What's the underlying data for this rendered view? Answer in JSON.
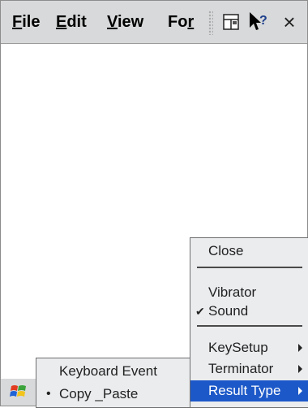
{
  "menubar": {
    "file": {
      "u": "F",
      "rest": "ile"
    },
    "edit": {
      "u": "E",
      "rest": "dit"
    },
    "view": {
      "u": "V",
      "rest": "iew"
    },
    "format": {
      "pre": "Fo",
      "u": "r"
    },
    "close_glyph": "×"
  },
  "main_menu": {
    "close": "Close",
    "vibrator": "Vibrator",
    "sound_check": "✔",
    "sound": "Sound",
    "keysetup": "KeySetup",
    "terminator": "Terminator",
    "result_type": "Result Type"
  },
  "sub_menu": {
    "keyboard_event": "Keyboard Event",
    "bullet": "•",
    "copy_paste": "Copy _Paste"
  },
  "colors": {
    "highlight": "#1c58c8",
    "bar": "#d8d9da",
    "menu_bg": "#ebecee"
  },
  "icons": {
    "layout": "layout-icon",
    "help": "help-arrow-icon",
    "close": "close-icon",
    "start": "windows-start-icon"
  }
}
